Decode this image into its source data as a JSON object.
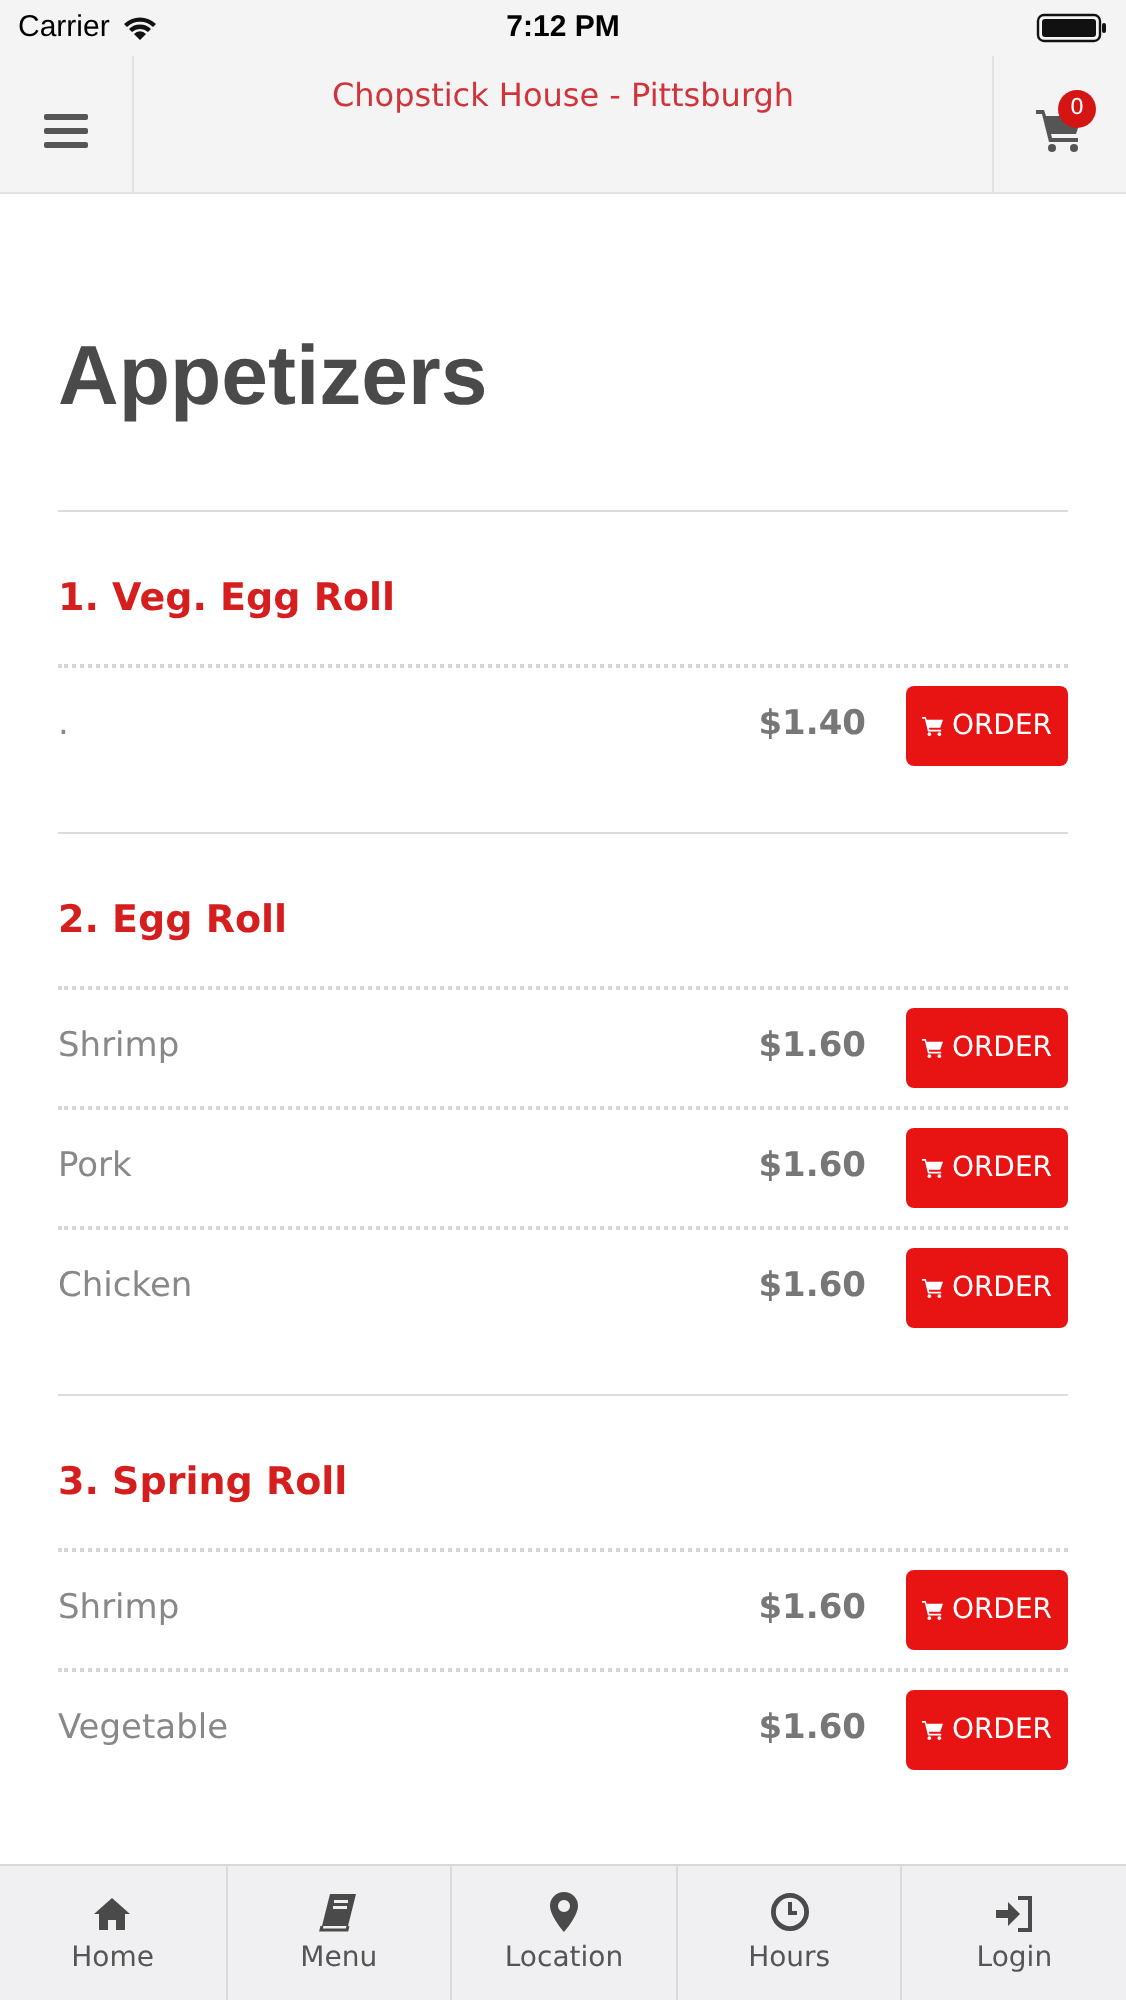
{
  "status_bar": {
    "carrier": "Carrier",
    "time": "7:12 PM"
  },
  "header": {
    "title": "Chopstick House - Pittsburgh",
    "cart_count": "0"
  },
  "page_title": "Appetizers",
  "sections": [
    {
      "title": "1. Veg. Egg Roll",
      "items": [
        {
          "name": ".",
          "price": "$1.40",
          "button": "ORDER"
        }
      ]
    },
    {
      "title": "2. Egg Roll",
      "items": [
        {
          "name": "Shrimp",
          "price": "$1.60",
          "button": "ORDER"
        },
        {
          "name": "Pork",
          "price": "$1.60",
          "button": "ORDER"
        },
        {
          "name": "Chicken",
          "price": "$1.60",
          "button": "ORDER"
        }
      ]
    },
    {
      "title": "3. Spring Roll",
      "items": [
        {
          "name": "Shrimp",
          "price": "$1.60",
          "button": "ORDER"
        },
        {
          "name": "Vegetable",
          "price": "$1.60",
          "button": "ORDER"
        }
      ]
    }
  ],
  "tab_bar": [
    {
      "label": "Home",
      "kind": "home"
    },
    {
      "label": "Menu",
      "kind": "menu"
    },
    {
      "label": "Location",
      "kind": "location"
    },
    {
      "label": "Hours",
      "kind": "hours"
    },
    {
      "label": "Login",
      "kind": "login"
    }
  ]
}
